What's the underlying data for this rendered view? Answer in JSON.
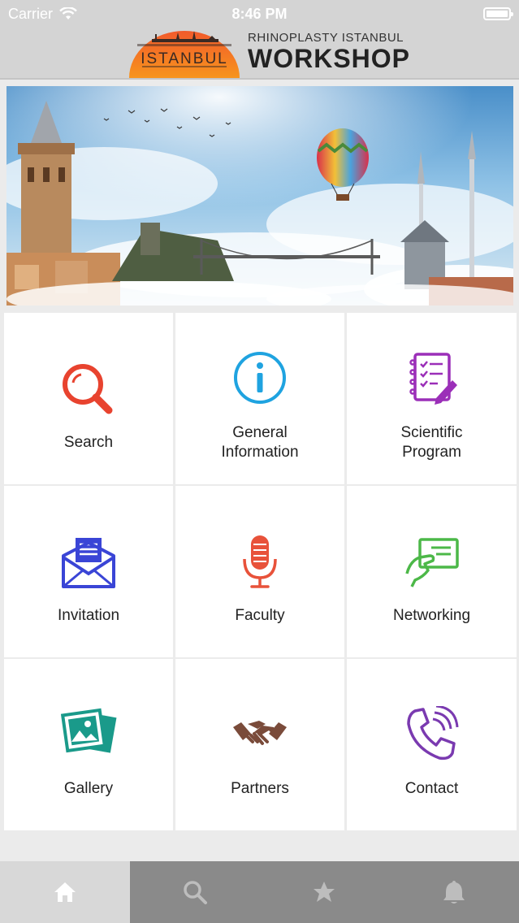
{
  "status_bar": {
    "carrier": "Carrier",
    "time": "8:46 PM"
  },
  "header": {
    "logo_badge_text": "ISTANBUL",
    "logo_subtitle": "RHINOPLASTY ISTANBUL",
    "logo_title": "WORKSHOP"
  },
  "menu": {
    "items": [
      {
        "label": "Search",
        "icon": "search-icon",
        "color": "#e8432f"
      },
      {
        "label": "General\nInformation",
        "icon": "info-icon",
        "color": "#1fa3e0"
      },
      {
        "label": "Scientific\nProgram",
        "icon": "checklist-icon",
        "color": "#9b2fb8"
      },
      {
        "label": "Invitation",
        "icon": "envelope-icon",
        "color": "#3a45d6"
      },
      {
        "label": "Faculty",
        "icon": "microphone-icon",
        "color": "#e8523a"
      },
      {
        "label": "Networking",
        "icon": "business-card-icon",
        "color": "#4cb848"
      },
      {
        "label": "Gallery",
        "icon": "photos-icon",
        "color": "#1a9a8a"
      },
      {
        "label": "Partners",
        "icon": "handshake-icon",
        "color": "#7a4b3a"
      },
      {
        "label": "Contact",
        "icon": "phone-icon",
        "color": "#7a3ab0"
      }
    ]
  },
  "tab_bar": {
    "tabs": [
      {
        "icon": "home-icon",
        "active": true
      },
      {
        "icon": "search-icon",
        "active": false
      },
      {
        "icon": "star-icon",
        "active": false
      },
      {
        "icon": "bell-icon",
        "active": false
      }
    ]
  },
  "colors": {
    "chrome": "#d4d4d4",
    "tab_inactive": "#8a8a8a",
    "tab_active": "#d8d8d8"
  }
}
